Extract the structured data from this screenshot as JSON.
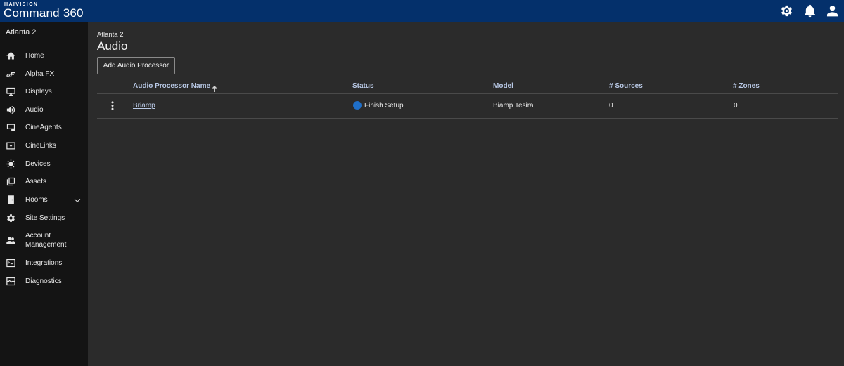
{
  "app": {
    "brand_small": "HAIVISION",
    "brand_name": "Command 360",
    "header_icons": [
      "gear-icon",
      "bell-icon",
      "user-icon"
    ],
    "colors": {
      "topbar": "#04306b",
      "sidebar": "#141414",
      "background": "#2b2b2b",
      "status_info": "#1f6fc9"
    }
  },
  "sidebar": {
    "site_name": "Atlanta 2",
    "items": [
      {
        "label": "Home",
        "icon": "home-icon"
      },
      {
        "label": "Alpha FX",
        "icon": "alpha-fx-icon"
      },
      {
        "label": "Displays",
        "icon": "monitor-icon"
      },
      {
        "label": "Audio",
        "icon": "speaker-icon"
      },
      {
        "label": "CineAgents",
        "icon": "cineagents-icon"
      },
      {
        "label": "CineLinks",
        "icon": "cinelinks-icon"
      },
      {
        "label": "Devices",
        "icon": "devices-icon"
      },
      {
        "label": "Assets",
        "icon": "assets-icon"
      },
      {
        "label": "Rooms",
        "icon": "rooms-icon"
      },
      {
        "label": "Site Settings",
        "icon": "gear-icon"
      },
      {
        "label": "Account\nManagement",
        "icon": "users-icon"
      },
      {
        "label": "Integrations",
        "icon": "terminal-icon"
      },
      {
        "label": "Diagnostics",
        "icon": "diagnostics-icon"
      }
    ]
  },
  "main": {
    "breadcrumb": "Atlanta 2",
    "title": "Audio",
    "add_button": "Add Audio Processor",
    "table": {
      "columns": [
        "Audio Processor Name",
        "Status",
        "Model",
        "# Sources",
        "# Zones"
      ],
      "sort": {
        "column": "Audio Processor Name",
        "direction": "ascending"
      },
      "rows": [
        {
          "name": "Briamp",
          "status": "Finish Setup",
          "model": "Biamp Tesira",
          "sources": "0",
          "zones": "0"
        }
      ]
    }
  }
}
